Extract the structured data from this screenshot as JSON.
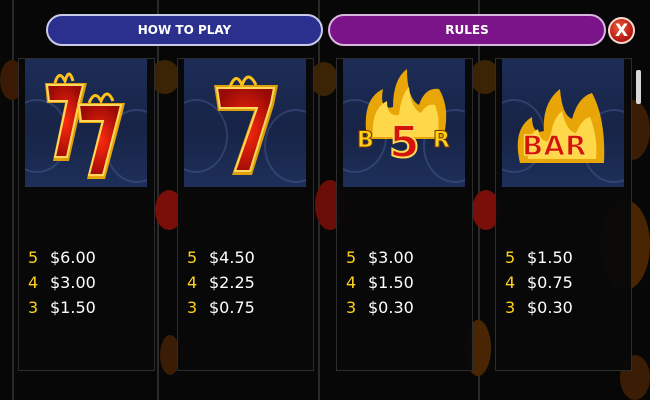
{
  "tabs": {
    "how_to_play": "HOW TO PLAY",
    "rules": "RULES"
  },
  "close_label": "X",
  "cards": [
    {
      "symbol": "double-seven",
      "image_text": "77",
      "pays": [
        {
          "count": "5",
          "amount": "$6.00"
        },
        {
          "count": "4",
          "amount": "$3.00"
        },
        {
          "count": "3",
          "amount": "$1.50"
        }
      ]
    },
    {
      "symbol": "single-seven",
      "image_text": "7",
      "pays": [
        {
          "count": "5",
          "amount": "$4.50"
        },
        {
          "count": "4",
          "amount": "$2.25"
        },
        {
          "count": "3",
          "amount": "$0.75"
        }
      ]
    },
    {
      "symbol": "bar-five",
      "image_text": "B5R",
      "pays": [
        {
          "count": "5",
          "amount": "$3.00"
        },
        {
          "count": "4",
          "amount": "$1.50"
        },
        {
          "count": "3",
          "amount": "$0.30"
        }
      ]
    },
    {
      "symbol": "bar",
      "image_text": "BAR",
      "pays": [
        {
          "count": "5",
          "amount": "$1.50"
        },
        {
          "count": "4",
          "amount": "$0.75"
        },
        {
          "count": "3",
          "amount": "$0.30"
        }
      ]
    }
  ],
  "colors": {
    "tab_how": "#2b2f8e",
    "tab_rules": "#7c1489",
    "close": "#c0180f",
    "count_yellow": "#ffd21c",
    "symbol_red": "#e8170a",
    "flame": "#ffb400"
  }
}
